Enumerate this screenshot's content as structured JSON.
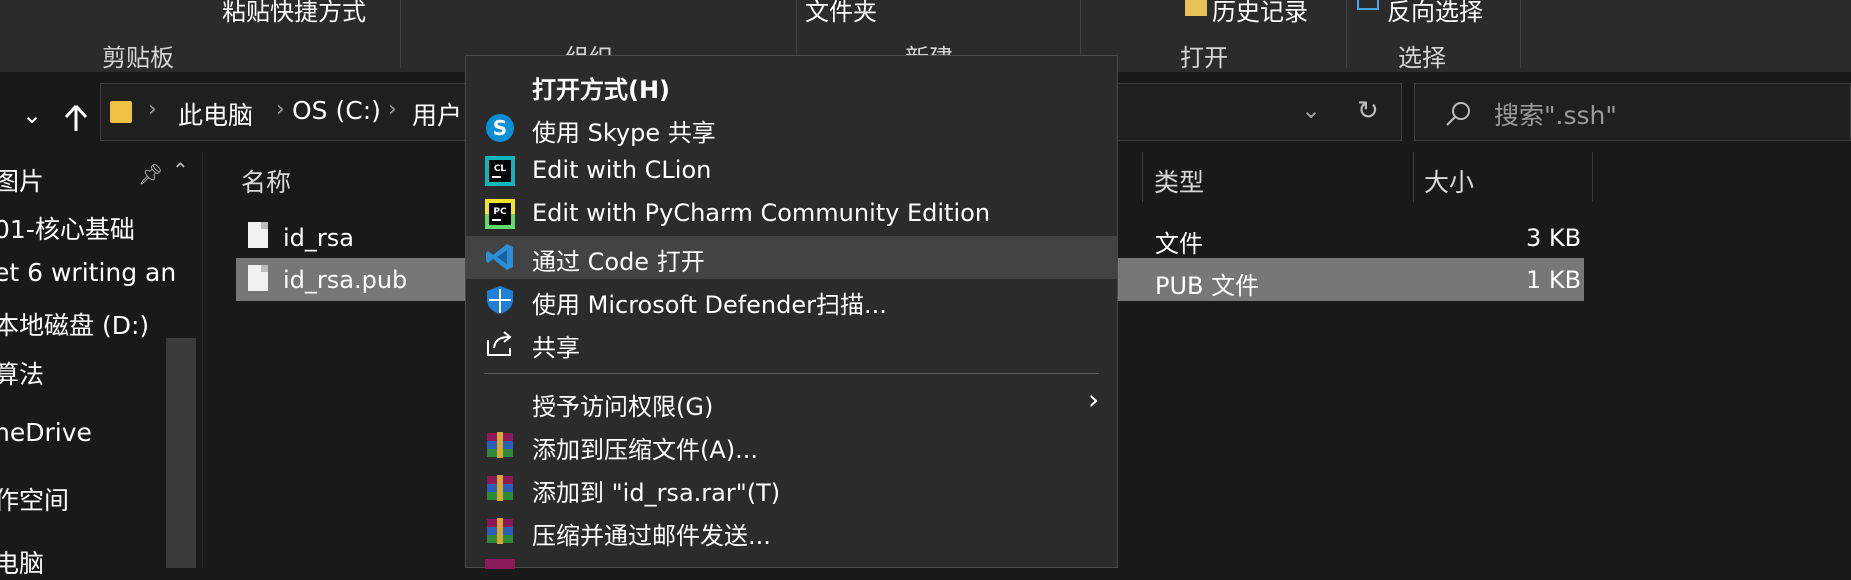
{
  "ribbon": {
    "groups": [
      "剪贴板",
      "组织",
      "新建",
      "打开",
      "选择"
    ],
    "top_items": [
      "粘贴快捷方式",
      "文件夹",
      "历史记录",
      "反向选择"
    ]
  },
  "address": {
    "crumbs": [
      "此电脑",
      "OS (C:)",
      "用户"
    ],
    "search_placeholder": "搜索\".ssh\""
  },
  "nav": {
    "items": [
      "图片",
      "01-核心基础",
      "et 6 writing an",
      "本地磁盘 (D:)",
      "算法",
      "neDrive",
      "作空间",
      "电脑"
    ]
  },
  "columns": [
    "名称",
    "类型",
    "大小"
  ],
  "files": [
    {
      "name": "id_rsa",
      "type": "文件",
      "size": "3 KB"
    },
    {
      "name": "id_rsa.pub",
      "type": "PUB 文件",
      "size": "1 KB"
    }
  ],
  "menu": {
    "items": [
      {
        "label": "打开方式(H)",
        "icon": "none"
      },
      {
        "label": "使用 Skype 共享",
        "icon": "skype-icon"
      },
      {
        "label": "Edit with CLion",
        "icon": "clion-icon"
      },
      {
        "label": "Edit with PyCharm Community Edition",
        "icon": "pycharm-icon"
      },
      {
        "label": "通过 Code 打开",
        "icon": "vscode-icon"
      },
      {
        "label": "使用 Microsoft Defender扫描...",
        "icon": "defender-icon"
      },
      {
        "label": "共享",
        "icon": "share-icon"
      },
      {
        "label": "授予访问权限(G)",
        "icon": "none"
      },
      {
        "label": "添加到压缩文件(A)...",
        "icon": "winrar-icon"
      },
      {
        "label": "添加到 \"id_rsa.rar\"(T)",
        "icon": "winrar-icon"
      },
      {
        "label": "压缩并通过邮件发送...",
        "icon": "winrar-icon"
      }
    ],
    "clion_icon_text": "CL",
    "pycharm_icon_text": "PC"
  },
  "colors": {
    "background": "#191919",
    "menu_background": "#2b2b2b",
    "menu_highlight": "#434343",
    "selected_row": "#777777",
    "skype": "#0a8fd8",
    "vscode": "#2b8fd8",
    "defender": "#1f7fd6"
  }
}
